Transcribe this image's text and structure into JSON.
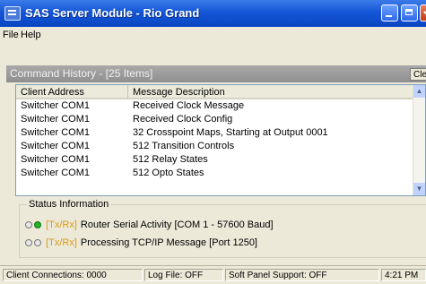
{
  "window": {
    "title": "SAS Server Module - Rio Grand"
  },
  "menu": {
    "file": "File",
    "help": "Help"
  },
  "command_history": {
    "label": "Command History - [25 Items]",
    "clear_label": "Clear"
  },
  "list": {
    "columns": [
      "Client Address",
      "Message Description"
    ],
    "rows": [
      {
        "client": "Switcher COM1",
        "message": "Received Clock Message"
      },
      {
        "client": "Switcher COM1",
        "message": "Received Clock Config"
      },
      {
        "client": "Switcher COM1",
        "message": "32 Crosspoint Maps, Starting at Output 0001"
      },
      {
        "client": "Switcher COM1",
        "message": "512 Transition Controls"
      },
      {
        "client": "Switcher COM1",
        "message": "512 Relay States"
      },
      {
        "client": "Switcher COM1",
        "message": "512 Opto States"
      }
    ]
  },
  "status_info": {
    "legend": "Status Information",
    "lines": [
      {
        "tag": "[Tx/Rx]",
        "text": "Router Serial Activity [COM 1 - 57600 Baud]"
      },
      {
        "tag": "[Tx/Rx]",
        "text": "Processing TCP/IP Message [Port 1250]"
      }
    ]
  },
  "statusbar": {
    "client_connections": "Client Connections: 0000",
    "log_file": "Log File: OFF",
    "soft_panel": "Soft Panel Support: OFF",
    "time": "4:21 PM"
  },
  "colors": {
    "titlebar": "#1456d6",
    "tag": "#d99b18",
    "led_on": "#22b422",
    "panel_header": "#999999"
  },
  "icons": [
    "app-icon",
    "minimize-icon",
    "maximize-icon",
    "close-icon",
    "scroll-up-icon",
    "scroll-down-icon"
  ]
}
